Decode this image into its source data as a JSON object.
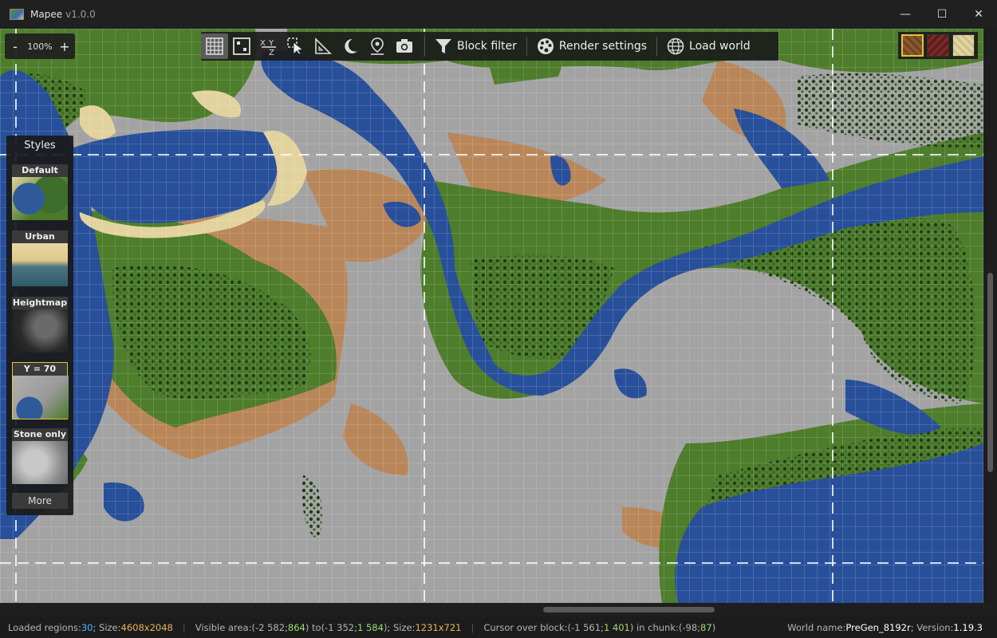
{
  "app": {
    "title": "Mapee",
    "version": "v1.0.0"
  },
  "window_controls": {
    "minimize": "—",
    "maximize": "☐",
    "close": "✕"
  },
  "zoom": {
    "minus": "-",
    "value": "100%",
    "plus": "+"
  },
  "toolbar": {
    "icons": [
      "grid-icon",
      "chunk-grid-icon",
      "coordinates-icon",
      "select-cursor-icon",
      "measure-icon",
      "night-mode-icon",
      "waypoint-icon",
      "screenshot-icon"
    ],
    "active": [
      "grid-icon"
    ],
    "block_filter": "Block filter",
    "render_settings": "Render settings",
    "load_world": "Load world"
  },
  "palette": {
    "swatches": [
      {
        "name": "dirt",
        "color": "#8a5a2e",
        "selected": true
      },
      {
        "name": "netherrack",
        "color": "#7a2a26",
        "selected": false
      },
      {
        "name": "sand",
        "color": "#e0d4a4",
        "selected": false
      }
    ]
  },
  "styles": {
    "title": "Styles",
    "items": [
      {
        "label": "Default",
        "selected": false
      },
      {
        "label": "Urban",
        "selected": false
      },
      {
        "label": "Heightmap",
        "selected": false
      },
      {
        "label": "Y = 70",
        "selected": true
      },
      {
        "label": "Stone only",
        "selected": false
      }
    ],
    "more": "More"
  },
  "status": {
    "loaded_label": "Loaded regions: ",
    "loaded_value": "30",
    "size_label": "; Size: ",
    "size_value": "4608x2048",
    "visible_label": "Visible area: ",
    "visible_from_a": "(-2 582; ",
    "visible_from_b": "864",
    "visible_to_label": ") to ",
    "visible_to_a": "(-1 352; ",
    "visible_to_b": "1 584",
    "visible_size_label": "); Size: ",
    "visible_size_value": "1231x721",
    "cursor_label": "Cursor over block: ",
    "cursor_a": "(-1 561; ",
    "cursor_b": "1 401",
    "chunk_label": ") in chunk: ",
    "chunk_a": "(-98; ",
    "chunk_b": "87",
    "chunk_end": ")",
    "world_label": "World name: ",
    "world_value": "PreGen_8192r",
    "version_label": "; Version: ",
    "version_value": "1.19.3"
  },
  "colors": {
    "water": "#284f9a",
    "grass": "#4e7d2c",
    "forest": "#2f5220",
    "stone": "#a3a3a3",
    "dirt": "#b98659",
    "sand": "#e2d39e",
    "selection": "#e3c23a"
  }
}
